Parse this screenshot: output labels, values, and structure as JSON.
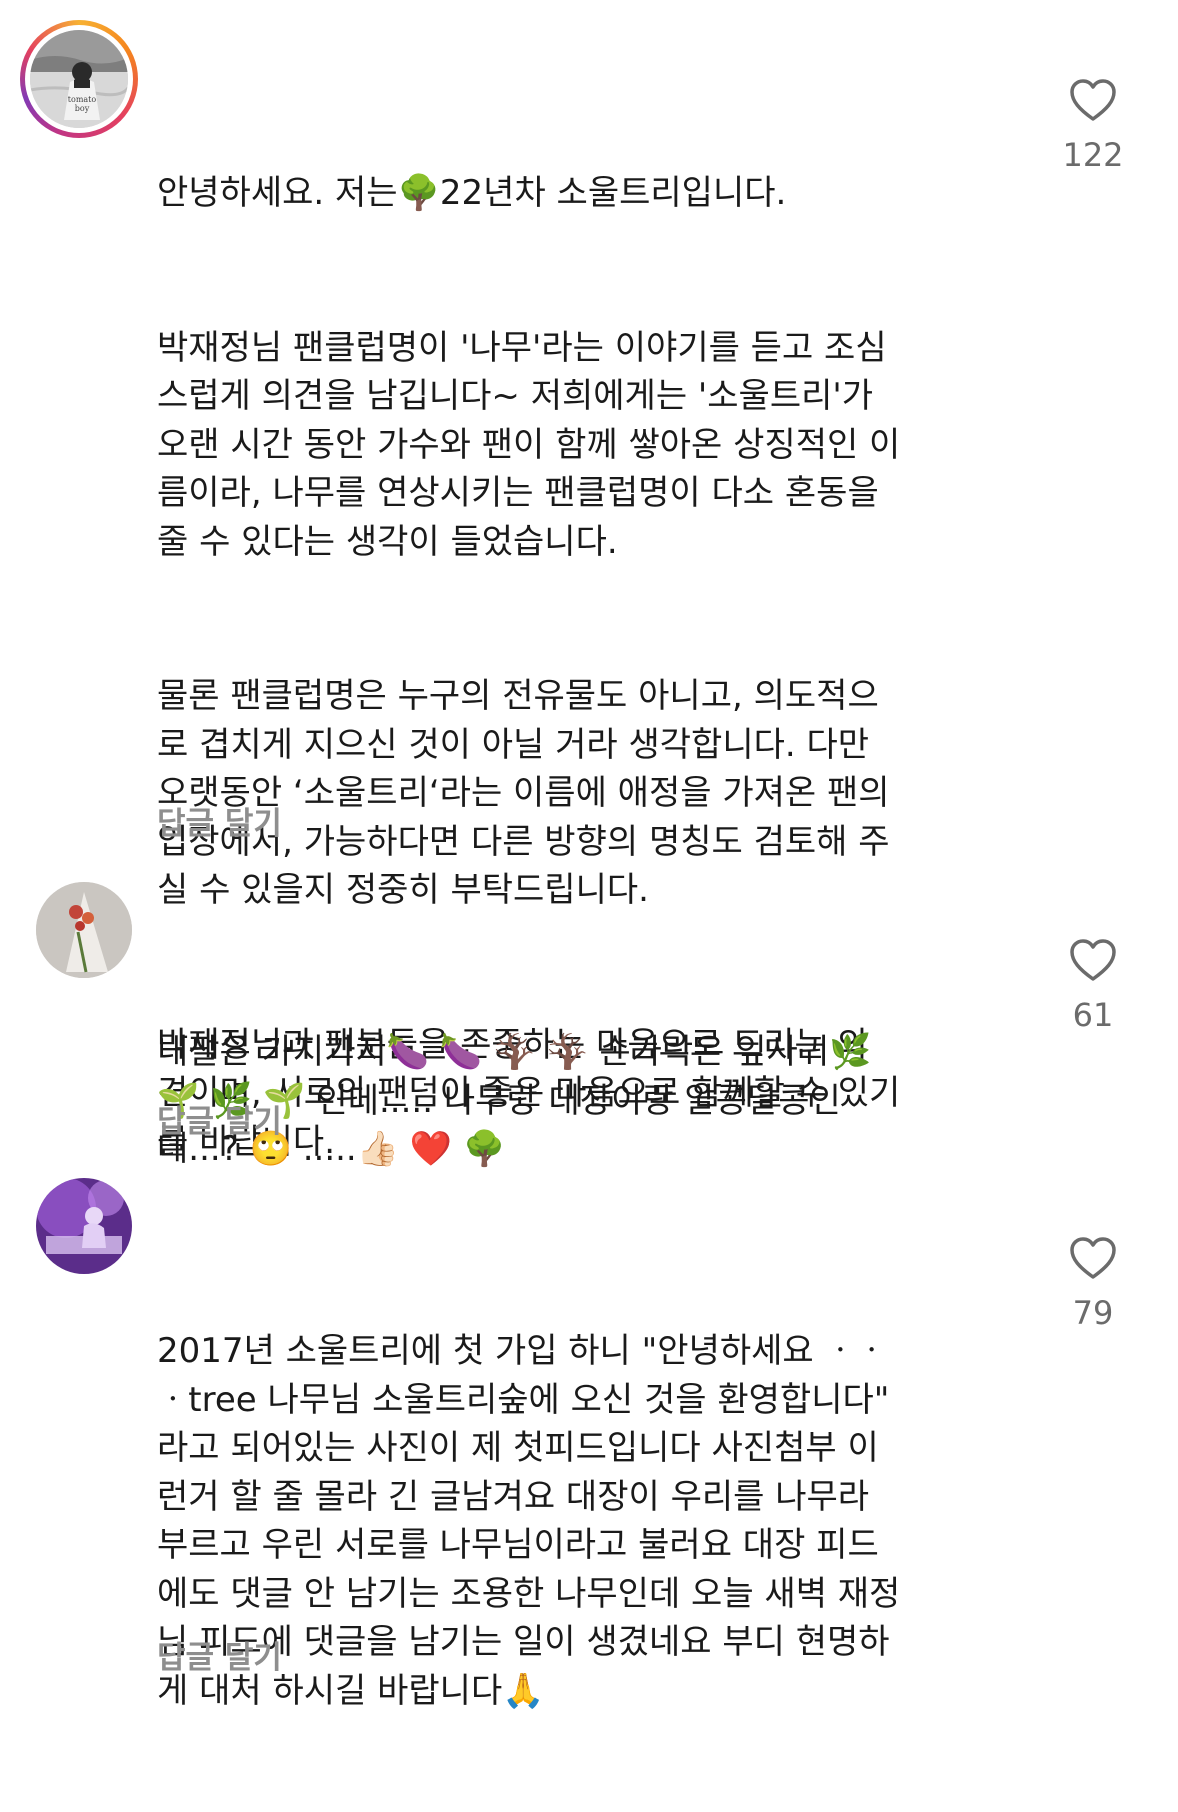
{
  "comments": [
    {
      "avatar": "tree-silhouette-photo-story-ring",
      "paragraphs": [
        "안녕하세요. 저는🌳22년차 소울트리입니다.",
        "박재정님 팬클럽명이 '나무'라는 이야기를 듣고 조심\n스럽게 의견을 남깁니다~ 저희에게는 '소울트리'가\n오랜 시간 동안 가수와 팬이 함께 쌓아온 상징적인 이\n름이라, 나무를 연상시키는 팬클럽명이 다소 혼동을\n줄 수 있다는 생각이 들었습니다.",
        "물론 팬클럽명은 누구의 전유물도 아니고, 의도적으\n로 겹치게 지으신 것이 아닐 거라 생각합니다. 다만\n오랫동안 ‘소울트리‘라는 이름에 애정을 가져온 팬의\n입장에서, 가능하다면 다른 방향의 명칭도 검토해 주\n실 수 있을지 정중히 부탁드립니다.",
        "박재정님과 팬분들을 존중하는 마음으로 드리는 의\n견이며, 서로의 팬덤이 좋은 마음으로 함께할 수 있기\n를 바랍니다."
      ],
      "reply_label": "답글 달기",
      "like_count": "122"
    },
    {
      "avatar": "flower-bouquet-photo",
      "paragraphs": [
        "내팔은 가지가지🍆 🍆 🪾 🪾 손가락은 잎사귀🌿\n🌱 🌿 🌱 인데..... 나무랑 대장이랑 알콩달콩인\n데...? 🙄 .....👍🏻 ❤️ 🌳"
      ],
      "reply_label": "답글 달기",
      "like_count": "61"
    },
    {
      "avatar": "concert-stage-photo",
      "paragraphs": [
        "2017년 소울트리에 첫 가입 하니 \"안녕하세요 ㆍㆍ\nㆍtree 나무님 소울트리숲에 오신 것을 환영합니다\"\n라고 되어있는 사진이 제 첫피드입니다 사진첨부 이\n런거 할 줄 몰라 긴 글남겨요 대장이 우리를 나무라\n부르고 우린 서로를 나무님이라고 불러요 대장 피드\n에도 댓글 안 남기는 조용한 나무인데 오늘 새벽 재정\n님 피드에 댓글을 남기는 일이 생겼네요 부디 현명하\n게 대처 하시길 바랍니다🙏"
      ],
      "reply_label": "답글 달기",
      "like_count": "79"
    }
  ],
  "colors": {
    "text": "#1a1a1a",
    "secondary": "#8e8e8e",
    "like_count": "#6b6b6b",
    "ring_start": "#f7b133",
    "ring_end": "#833ab4"
  }
}
